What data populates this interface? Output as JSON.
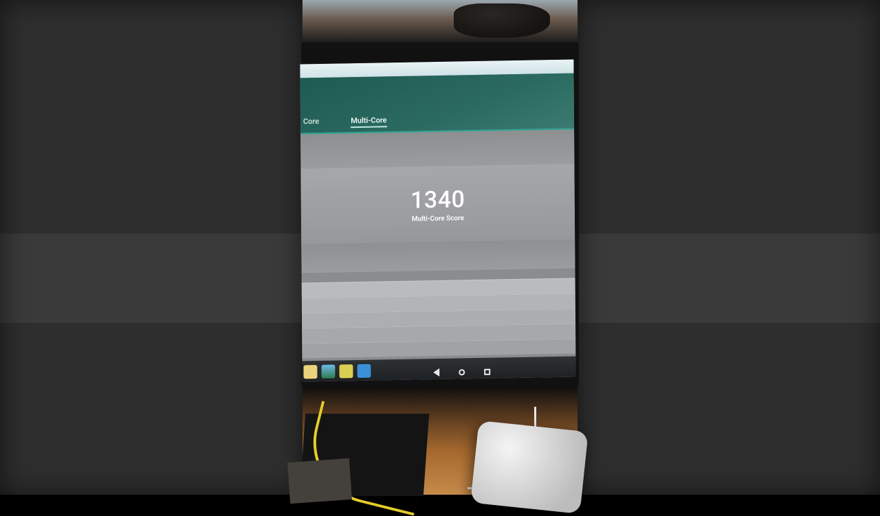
{
  "tabs": {
    "single_core_partial": "Core",
    "multi_core": "Multi-Core"
  },
  "score": {
    "value": "1340",
    "label": "Multi-Core Score"
  },
  "dock": {
    "items": [
      {
        "name": "files-icon"
      },
      {
        "name": "gallery-icon"
      },
      {
        "name": "play-store-icon"
      },
      {
        "name": "settings-icon"
      }
    ]
  },
  "nav": {
    "back": "back-button",
    "home": "home-button",
    "recent": "recent-apps-button"
  }
}
